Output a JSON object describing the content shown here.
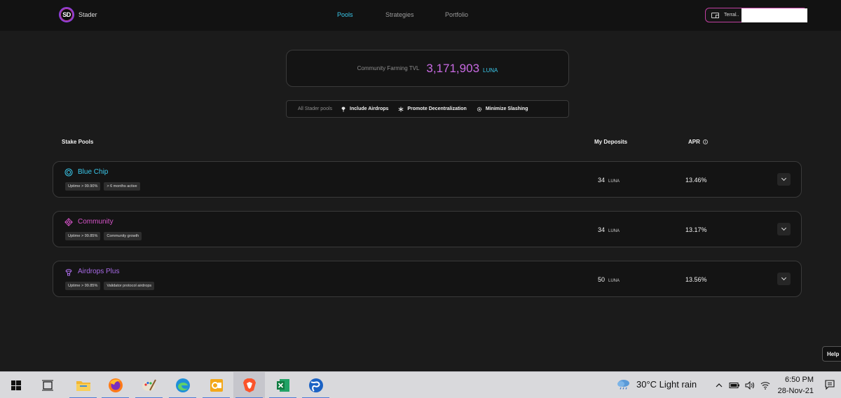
{
  "header": {
    "logo_text": "SD",
    "brand": "Stader",
    "nav": [
      {
        "label": "Pools",
        "active": true
      },
      {
        "label": "Strategies",
        "active": false
      },
      {
        "label": "Portfolio",
        "active": false
      }
    ],
    "wallet_label": "Terral..",
    "accent_color": "#3ac7ea",
    "brand_color": "#c03fa0"
  },
  "tvl": {
    "label": "Community Farming TVL",
    "value": "3,171,903",
    "unit": "LUNA"
  },
  "filters": {
    "all_label": "All Stader pools",
    "items": [
      {
        "label": "Include Airdrops",
        "icon": "airdrop-icon"
      },
      {
        "label": "Promote Decentralization",
        "icon": "asterisk-icon"
      },
      {
        "label": "Minimize Slashing",
        "icon": "gear-icon"
      }
    ]
  },
  "table": {
    "col_pools": "Stake Pools",
    "col_deposits": "My Deposits",
    "col_apr": "APR"
  },
  "pools": [
    {
      "name": "Blue Chip",
      "color": "#3ac7ea",
      "icon": "target-icon",
      "tags": [
        "Uptime > 99.90%",
        "> 6 months active"
      ],
      "deposit": "34",
      "deposit_unit": "LUNA",
      "apr": "13.46%"
    },
    {
      "name": "Community",
      "color": "#d553c8",
      "icon": "network-icon",
      "tags": [
        "Uptime > 99.85%",
        "Community growth"
      ],
      "deposit": "34",
      "deposit_unit": "LUNA",
      "apr": "13.17%"
    },
    {
      "name": "Airdrops Plus",
      "color": "#a86ae6",
      "icon": "airdrop-icon",
      "tags": [
        "Uptime > 99.85%",
        "Validator protocol airdrops"
      ],
      "deposit": "50",
      "deposit_unit": "LUNA",
      "apr": "13.56%"
    }
  ],
  "help_label": "Help",
  "taskbar": {
    "weather": "30°C  Light rain",
    "time": "6:50 PM",
    "date": "28-Nov-21"
  }
}
